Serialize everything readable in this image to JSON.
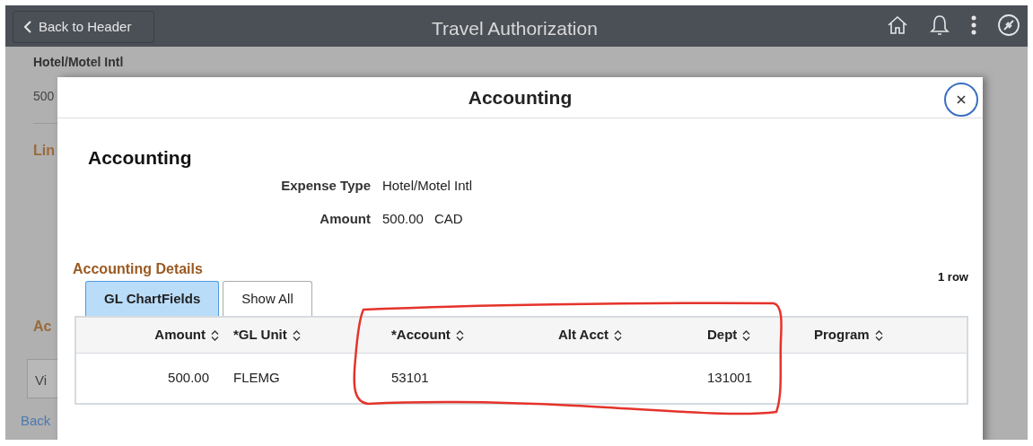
{
  "header": {
    "back_button": "Back to Header",
    "title": "Travel Authorization"
  },
  "background": {
    "line_title": "Hotel/Motel Intl",
    "amount": "500",
    "section_1": "Lin",
    "section_2": "Ac",
    "button": "Vi",
    "back_link": "Back"
  },
  "modal": {
    "title": "Accounting",
    "heading": "Accounting",
    "fields": [
      {
        "label": "Expense Type",
        "values": [
          "Hotel/Motel Intl"
        ]
      },
      {
        "label": "Amount",
        "values": [
          "500.00",
          "CAD"
        ]
      }
    ],
    "details": {
      "title": "Accounting Details",
      "row_count": "1 row",
      "tabs": [
        {
          "label": "GL ChartFields",
          "selected": true
        },
        {
          "label": "Show All",
          "selected": false
        }
      ],
      "columns": [
        "Amount",
        "*GL Unit",
        "*Account",
        "Alt Acct",
        "Dept",
        "Program"
      ],
      "rows": [
        [
          "500.00",
          "FLEMG",
          "53101",
          "",
          "131001",
          ""
        ]
      ]
    }
  }
}
